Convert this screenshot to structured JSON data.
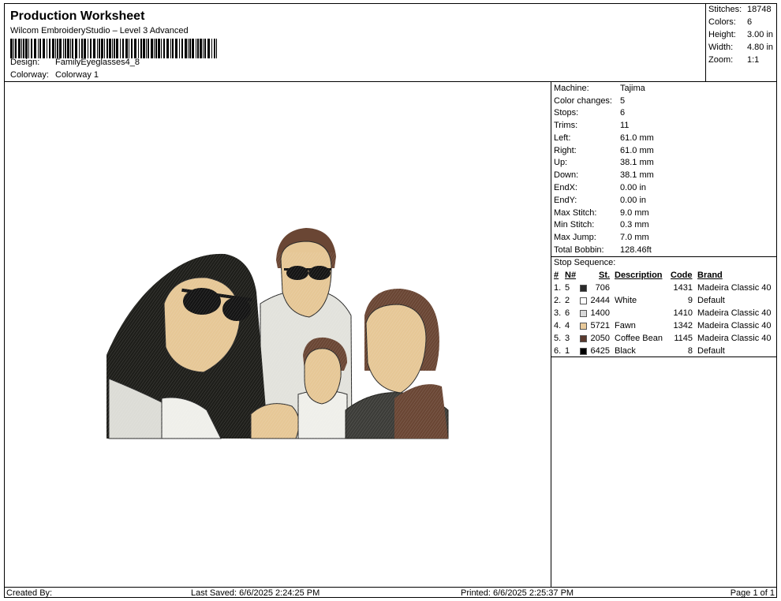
{
  "header": {
    "title": "Production Worksheet",
    "subtitle": "Wilcom EmbroideryStudio – Level 3 Advanced",
    "design_label": "Design:",
    "design_value": "FamilyEyeglasses4_8",
    "colorway_label": "Colorway:",
    "colorway_value": "Colorway 1"
  },
  "stats": [
    {
      "label": "Stitches:",
      "value": "18748"
    },
    {
      "label": "Colors:",
      "value": "6"
    },
    {
      "label": "Height:",
      "value": "3.00 in"
    },
    {
      "label": "Width:",
      "value": "4.80 in"
    },
    {
      "label": "Zoom:",
      "value": "1:1"
    }
  ],
  "info": [
    {
      "label": "Machine:",
      "value": "Tajima"
    },
    {
      "label": "Color changes:",
      "value": "5"
    },
    {
      "label": "Stops:",
      "value": "6"
    },
    {
      "label": "Trims:",
      "value": "11"
    },
    {
      "label": "Left:",
      "value": "61.0 mm"
    },
    {
      "label": "Right:",
      "value": "61.0 mm"
    },
    {
      "label": "Up:",
      "value": "38.1 mm"
    },
    {
      "label": "Down:",
      "value": "38.1 mm"
    },
    {
      "label": "EndX:",
      "value": "0.00 in"
    },
    {
      "label": "EndY:",
      "value": "0.00 in"
    },
    {
      "label": "Max Stitch:",
      "value": "9.0 mm"
    },
    {
      "label": "Min Stitch:",
      "value": "0.3 mm"
    },
    {
      "label": "Max Jump:",
      "value": "7.0 mm"
    },
    {
      "label": "Total Bobbin:",
      "value": "128.46ft"
    }
  ],
  "sequence": {
    "title": "Stop Sequence:",
    "headers": {
      "hash": "#",
      "n": "N#",
      "st": "St.",
      "description": "Description",
      "code": "Code",
      "brand": "Brand"
    },
    "rows": [
      {
        "num": "1.",
        "n": "5",
        "color": "#2a2a2a",
        "st": "706",
        "description": "",
        "code": "1431",
        "brand": "Madeira Classic 40"
      },
      {
        "num": "2.",
        "n": "2",
        "color": "#ffffff",
        "st": "2444",
        "description": "White",
        "code": "9",
        "brand": "Default"
      },
      {
        "num": "3.",
        "n": "6",
        "color": "#d8d8d8",
        "st": "1400",
        "description": "",
        "code": "1410",
        "brand": "Madeira Classic 40"
      },
      {
        "num": "4.",
        "n": "4",
        "color": "#e8c99a",
        "st": "5721",
        "description": "Fawn",
        "code": "1342",
        "brand": "Madeira Classic 40"
      },
      {
        "num": "5.",
        "n": "3",
        "color": "#5a3a2e",
        "st": "2050",
        "description": "Coffee Bean",
        "code": "1145",
        "brand": "Madeira Classic 40"
      },
      {
        "num": "6.",
        "n": "1",
        "color": "#000000",
        "st": "6425",
        "description": "Black",
        "code": "8",
        "brand": "Default"
      }
    ]
  },
  "footer": {
    "created_by": "Created By:",
    "last_saved": "Last Saved: 6/6/2025 2:24:25 PM",
    "printed": "Printed: 6/6/2025 2:25:37 PM",
    "page": "Page 1 of 1"
  },
  "colors": {
    "hair_black": "#1e1e1a",
    "skin": "#e6c796",
    "brown": "#6a4634",
    "light_gray": "#dcdcd6",
    "dark_gray": "#3c3c38",
    "white_fabric": "#efefea"
  }
}
